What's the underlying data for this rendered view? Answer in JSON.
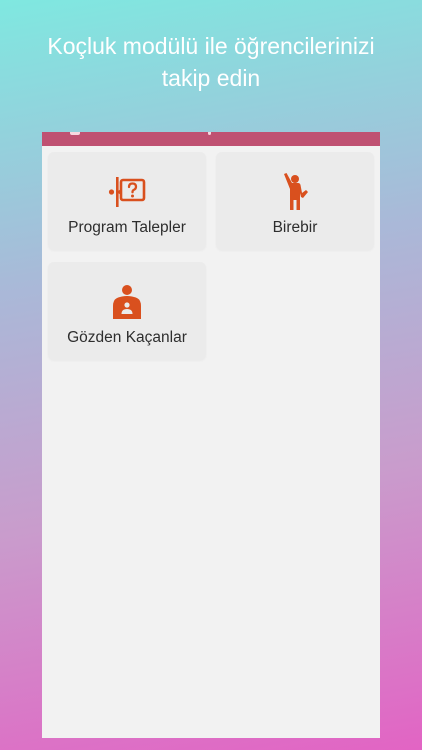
{
  "promo": {
    "line1": "Koçluk modülü ile öğrencilerinizi",
    "line2": "takip edin"
  },
  "colors": {
    "accent": "#d9501e",
    "appbar": "#bf5172",
    "gradient_top": "#7fe8e0",
    "gradient_bottom": "#e264c4",
    "screen_bg": "#f2f2f2",
    "tile_bg": "#ebebeb"
  },
  "menu": {
    "items": [
      {
        "label": "Program Talepler",
        "icon": "presenter-question-icon"
      },
      {
        "label": "Birebir",
        "icon": "person-raising-hand-icon"
      },
      {
        "label": "Gözden Kaçanlar",
        "icon": "person-badge-icon"
      }
    ]
  }
}
